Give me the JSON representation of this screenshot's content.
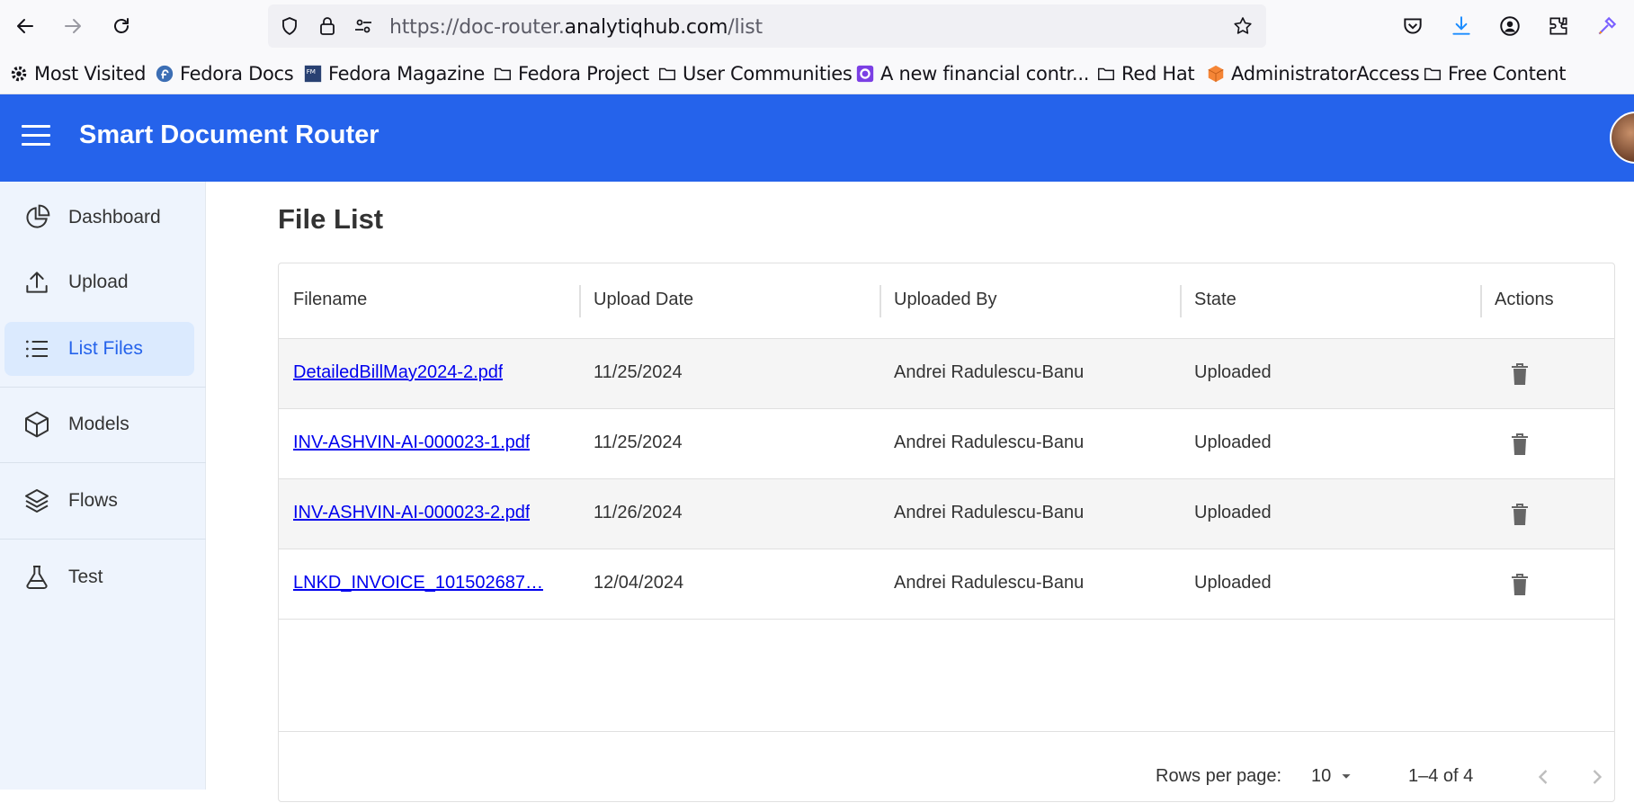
{
  "browser": {
    "url_prefix": "https://doc-router.",
    "url_domain": "analytiqhub.com",
    "url_path": "/list",
    "bookmarks": [
      {
        "label": "Most Visited",
        "icon": "gear-icon"
      },
      {
        "label": "Fedora Docs",
        "icon": "fedora-icon"
      },
      {
        "label": "Fedora Magazine",
        "icon": "fm-icon"
      },
      {
        "label": "Fedora Project",
        "icon": "folder-icon"
      },
      {
        "label": "User Communities",
        "icon": "folder-icon"
      },
      {
        "label": "A new financial contr...",
        "icon": "lifebuoy-icon"
      },
      {
        "label": "Red Hat",
        "icon": "folder-icon"
      },
      {
        "label": "AdministratorAccess",
        "icon": "cube-icon"
      },
      {
        "label": "Free Content",
        "icon": "folder-icon"
      }
    ]
  },
  "app": {
    "title": "Smart Document Router"
  },
  "sidebar": {
    "items": [
      {
        "label": "Dashboard",
        "icon": "pie-chart-icon"
      },
      {
        "label": "Upload",
        "icon": "upload-icon"
      },
      {
        "label": "List Files",
        "icon": "list-icon",
        "active": true
      },
      {
        "label": "Models",
        "icon": "cube-icon"
      },
      {
        "label": "Flows",
        "icon": "layers-icon"
      },
      {
        "label": "Test",
        "icon": "flask-icon"
      }
    ]
  },
  "main": {
    "title": "File List",
    "columns": [
      "Filename",
      "Upload Date",
      "Uploaded By",
      "State",
      "Actions"
    ],
    "rows": [
      {
        "filename": "DetailedBillMay2024-2.pdf",
        "date": "11/25/2024",
        "by": "Andrei Radulescu-Banu",
        "state": "Uploaded"
      },
      {
        "filename": "INV-ASHVIN-AI-000023-1.pdf",
        "date": "11/25/2024",
        "by": "Andrei Radulescu-Banu",
        "state": "Uploaded"
      },
      {
        "filename": "INV-ASHVIN-AI-000023-2.pdf",
        "date": "11/26/2024",
        "by": "Andrei Radulescu-Banu",
        "state": "Uploaded"
      },
      {
        "filename": "LNKD_INVOICE_101502687…",
        "date": "12/04/2024",
        "by": "Andrei Radulescu-Banu",
        "state": "Uploaded"
      }
    ],
    "pagination": {
      "rows_per_page_label": "Rows per page:",
      "rows_per_page": "10",
      "range": "1–4 of 4"
    }
  },
  "colors": {
    "accent": "#2563eb",
    "sidebar_bg": "#eef4fd",
    "active_bg": "#dbeafe"
  }
}
